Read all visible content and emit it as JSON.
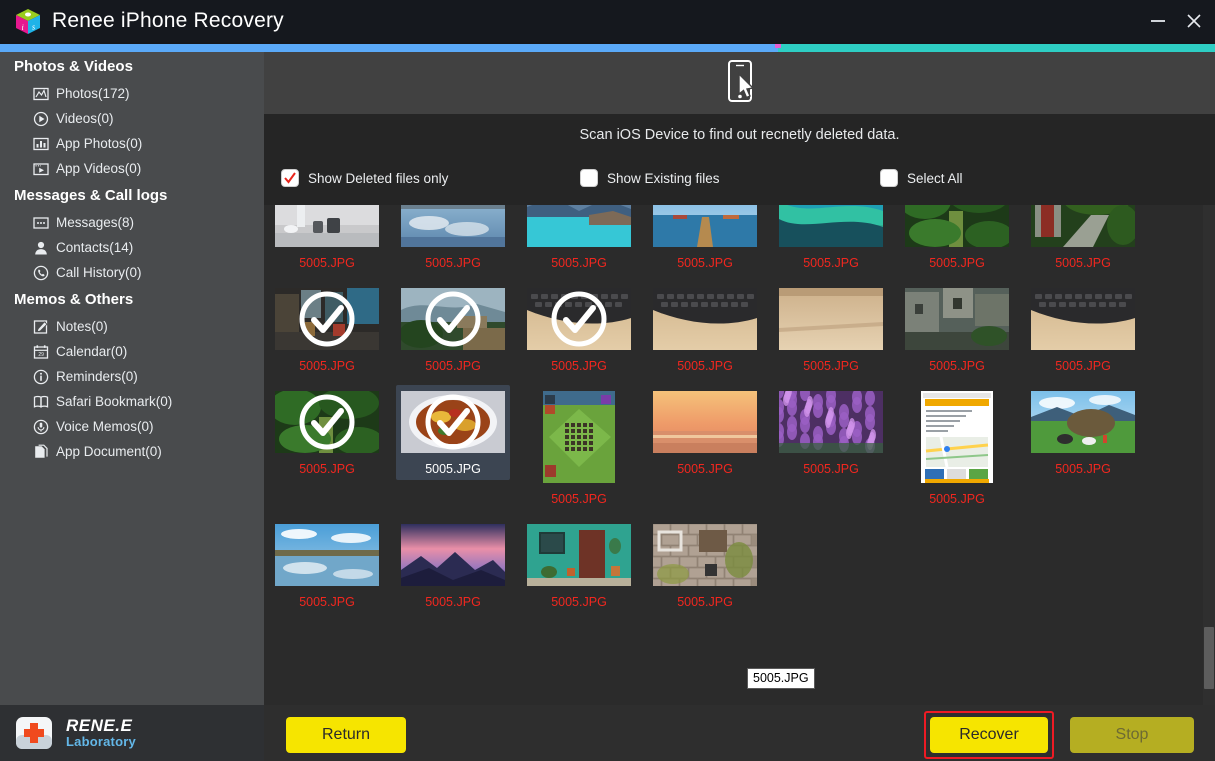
{
  "window": {
    "title": "Renee iPhone Recovery",
    "logo_icon": "renee-cube-icon",
    "minimize_icon": "minimize-icon",
    "close_icon": "close-icon"
  },
  "progress": {
    "blue_percent": 64,
    "blue_color": "#5aa9f8",
    "teal_color": "#2ecec4",
    "marker_color": "#e45fd0"
  },
  "sidebar": {
    "groups": [
      {
        "label": "Photos & Videos",
        "items": [
          {
            "label": "Photos(172)",
            "icon": "photo-icon"
          },
          {
            "label": "Videos(0)",
            "icon": "play-circle-icon"
          },
          {
            "label": "App Photos(0)",
            "icon": "bar-chart-icon"
          },
          {
            "label": "App Videos(0)",
            "icon": "video-frame-icon"
          }
        ]
      },
      {
        "label": "Messages & Call logs",
        "items": [
          {
            "label": "Messages(8)",
            "icon": "message-icon"
          },
          {
            "label": "Contacts(14)",
            "icon": "person-icon"
          },
          {
            "label": "Call History(0)",
            "icon": "phone-circle-icon"
          }
        ]
      },
      {
        "label": "Memos & Others",
        "items": [
          {
            "label": "Notes(0)",
            "icon": "note-pencil-icon"
          },
          {
            "label": "Calendar(0)",
            "icon": "calendar-icon"
          },
          {
            "label": "Reminders(0)",
            "icon": "info-circle-icon"
          },
          {
            "label": "Safari Bookmark(0)",
            "icon": "book-icon"
          },
          {
            "label": "Voice Memos(0)",
            "icon": "microphone-circle-icon"
          },
          {
            "label": "App Document(0)",
            "icon": "document-icon"
          }
        ]
      }
    ],
    "brand": {
      "name": "RENE.E",
      "sub": "Laboratory",
      "icon": "medical-cross-icon"
    }
  },
  "main": {
    "device_icon": "iphone-scan-icon",
    "scan_caption": "Scan iOS Device to find out recnetly deleted data.",
    "filters": [
      {
        "label": "Show Deleted files only",
        "checked": true
      },
      {
        "label": "Show Existing files",
        "checked": false
      },
      {
        "label": "Select All",
        "checked": false
      }
    ],
    "tooltip": "5005.JPG",
    "file_label": "5005.JPG",
    "label_color": "#f1271f",
    "grid": {
      "columns": 7,
      "rows": [
        [
          {
            "label": "5005.JPG",
            "selected": false,
            "hovered": false,
            "art": "kitchen"
          },
          {
            "label": "5005.JPG",
            "selected": false,
            "hovered": false,
            "art": "lake-clouds"
          },
          {
            "label": "5005.JPG",
            "selected": false,
            "hovered": false,
            "art": "turquoise-lake"
          },
          {
            "label": "5005.JPG",
            "selected": false,
            "hovered": false,
            "art": "pier"
          },
          {
            "label": "5005.JPG",
            "selected": false,
            "hovered": false,
            "art": "aurora-water"
          },
          {
            "label": "5005.JPG",
            "selected": false,
            "hovered": false,
            "art": "forest"
          },
          {
            "label": "5005.JPG",
            "selected": false,
            "hovered": false,
            "art": "red-door-path"
          }
        ],
        [
          {
            "label": "5005.JPG",
            "selected": true,
            "hovered": false,
            "art": "street-market"
          },
          {
            "label": "5005.JPG",
            "selected": true,
            "hovered": false,
            "art": "hill-village"
          },
          {
            "label": "5005.JPG",
            "selected": true,
            "hovered": false,
            "art": "keyboard"
          },
          {
            "label": "5005.JPG",
            "selected": false,
            "hovered": false,
            "art": "keyboard"
          },
          {
            "label": "5005.JPG",
            "selected": false,
            "hovered": false,
            "art": "desk-wood"
          },
          {
            "label": "5005.JPG",
            "selected": false,
            "hovered": false,
            "art": "alley-house"
          },
          {
            "label": "5005.JPG",
            "selected": false,
            "hovered": false,
            "art": "keyboard"
          }
        ],
        [
          {
            "label": "5005.JPG",
            "selected": true,
            "hovered": false,
            "art": "forest"
          },
          {
            "label": "5005.JPG",
            "selected": true,
            "hovered": true,
            "art": "food-plate"
          },
          {
            "label": "5005.JPG",
            "selected": false,
            "hovered": false,
            "art": "game-base"
          },
          {
            "label": "5005.JPG",
            "selected": false,
            "hovered": false,
            "art": "sunset-sea"
          },
          {
            "label": "5005.JPG",
            "selected": false,
            "hovered": false,
            "art": "lavender"
          },
          {
            "label": "5005.JPG",
            "selected": false,
            "hovered": false,
            "art": "map-page"
          },
          {
            "label": "5005.JPG",
            "selected": false,
            "hovered": false,
            "art": "pasture"
          }
        ],
        [
          {
            "label": "5005.JPG",
            "selected": false,
            "hovered": false,
            "art": "reflection-lake"
          },
          {
            "label": "5005.JPG",
            "selected": false,
            "hovered": false,
            "art": "pink-mountains"
          },
          {
            "label": "5005.JPG",
            "selected": false,
            "hovered": false,
            "art": "teal-door"
          },
          {
            "label": "5005.JPG",
            "selected": false,
            "hovered": false,
            "art": "brick-shelf"
          }
        ]
      ]
    }
  },
  "footer": {
    "return_label": "Return",
    "recover_label": "Recover",
    "stop_label": "Stop",
    "recover_highlight_color": "#ee1b24",
    "button_color": "#f6e500",
    "stop_disabled": true
  }
}
